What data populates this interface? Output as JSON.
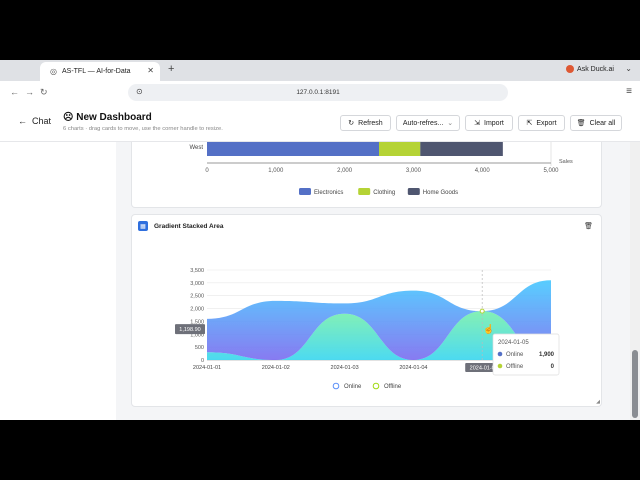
{
  "browser": {
    "tab_title": "AS-TFL — AI-for-Data",
    "url": "127.0.0.1:8191",
    "ask_duck": "Ask Duck.ai"
  },
  "app": {
    "back_label": "Chat",
    "title": "New Dashboard",
    "subtitle": "6 charts · drag cards to move, use the corner handle to resize.",
    "buttons": {
      "refresh": "Refresh",
      "auto_refresh": "Auto-refres...",
      "import": "Import",
      "export": "Export",
      "clear_all": "Clear all"
    }
  },
  "bar_card": {
    "chart_data": {
      "type": "bar",
      "orientation": "horizontal",
      "stacked": true,
      "categories": [
        "West"
      ],
      "series": [
        {
          "name": "Electronics",
          "color": "#5470c6",
          "values": [
            2500
          ]
        },
        {
          "name": "Clothing",
          "color": "#b5d335",
          "values": [
            600
          ]
        },
        {
          "name": "Home Goods",
          "color": "#4f5670",
          "values": [
            1200
          ]
        }
      ],
      "xlabel": "Sales",
      "xlim": [
        0,
        5000
      ],
      "xticks": [
        "0",
        "1,000",
        "2,000",
        "3,000",
        "4,000",
        "5,000"
      ]
    }
  },
  "area_card": {
    "title": "Gradient Stacked Area",
    "chart_data": {
      "type": "area",
      "x": [
        "2024-01-01",
        "2024-01-02",
        "2024-01-03",
        "2024-01-04",
        "2024-01-05",
        "2024-01-06"
      ],
      "series": [
        {
          "name": "Online",
          "color": "#5b8ff9",
          "values": [
            1300,
            2300,
            400,
            2700,
            0,
            3100
          ]
        },
        {
          "name": "Offline",
          "color": "#a0d911",
          "values": [
            300,
            0,
            1800,
            0,
            1900,
            0
          ]
        }
      ],
      "ylim": [
        0,
        3500
      ],
      "yticks": [
        "0",
        "500",
        "1,000",
        "1,500",
        "2,000",
        "2,500",
        "3,000",
        "3,500"
      ],
      "crosshair_y_label": "1,198.90",
      "crosshair_x_label": "2024-01-05",
      "tooltip": {
        "title": "2024-01-05",
        "rows": [
          {
            "name": "Online",
            "value": "1,900",
            "color": "#5470c6"
          },
          {
            "name": "Offline",
            "value": "0",
            "color": "#b5d335"
          }
        ]
      }
    }
  }
}
